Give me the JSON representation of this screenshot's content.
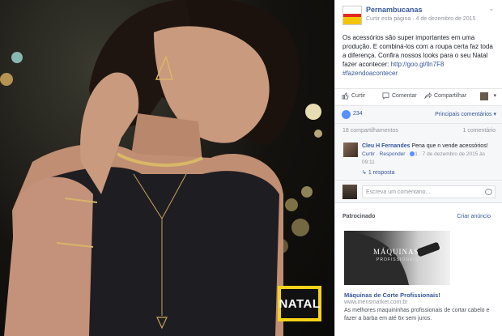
{
  "post": {
    "page_name": "Pernambucanas",
    "meta_link": "Curtir esta página",
    "meta_sep": " · ",
    "date": "4 de dezembro de 2015",
    "text_1": "Os acessórios são super importantes em uma produção. E combiná-los com a roupa certa faz toda a diferença. Confira nossos looks para o seu Natal fazer acontecer: ",
    "link": "http://goo.gl/lln7F8",
    "hashtag": "#fazendoacontecer",
    "photo_badge": "NATAL"
  },
  "actions": {
    "like": "Curtir",
    "comment": "Comentar",
    "share": "Compartilhar"
  },
  "reactions": {
    "count": "234",
    "top_comments": "Principais comentários"
  },
  "counts": {
    "shares": "18 compartilhamentos",
    "comments": "1 comentário"
  },
  "comment": {
    "author": "Cleu H Fernandes",
    "text": "Pena que n vende acessórios!",
    "like": "Curtir",
    "reply": "Responder",
    "likes": "1",
    "date": "7 de dezembro de 2015 às 09:11",
    "replies": "1 resposta"
  },
  "compose": {
    "placeholder": "Escreva um comentário..."
  },
  "sponsored": {
    "label": "Patrocinado",
    "create": "Criar anúncio",
    "ad_brand": "MÁQUINAS",
    "ad_brand_sub": "PROFISSIONAIS",
    "ad_title": "Máquinas de Corte Profissionais!",
    "ad_url": "www.mensmarket.com.br",
    "ad_desc": "As melhores maquininhas profissionais de cortar cabelo e fazer a barba em até 6x sem juros."
  },
  "colors": {
    "link": "#365899",
    "like_blue": "#5890ff",
    "natal_yellow": "#f6d31a"
  }
}
